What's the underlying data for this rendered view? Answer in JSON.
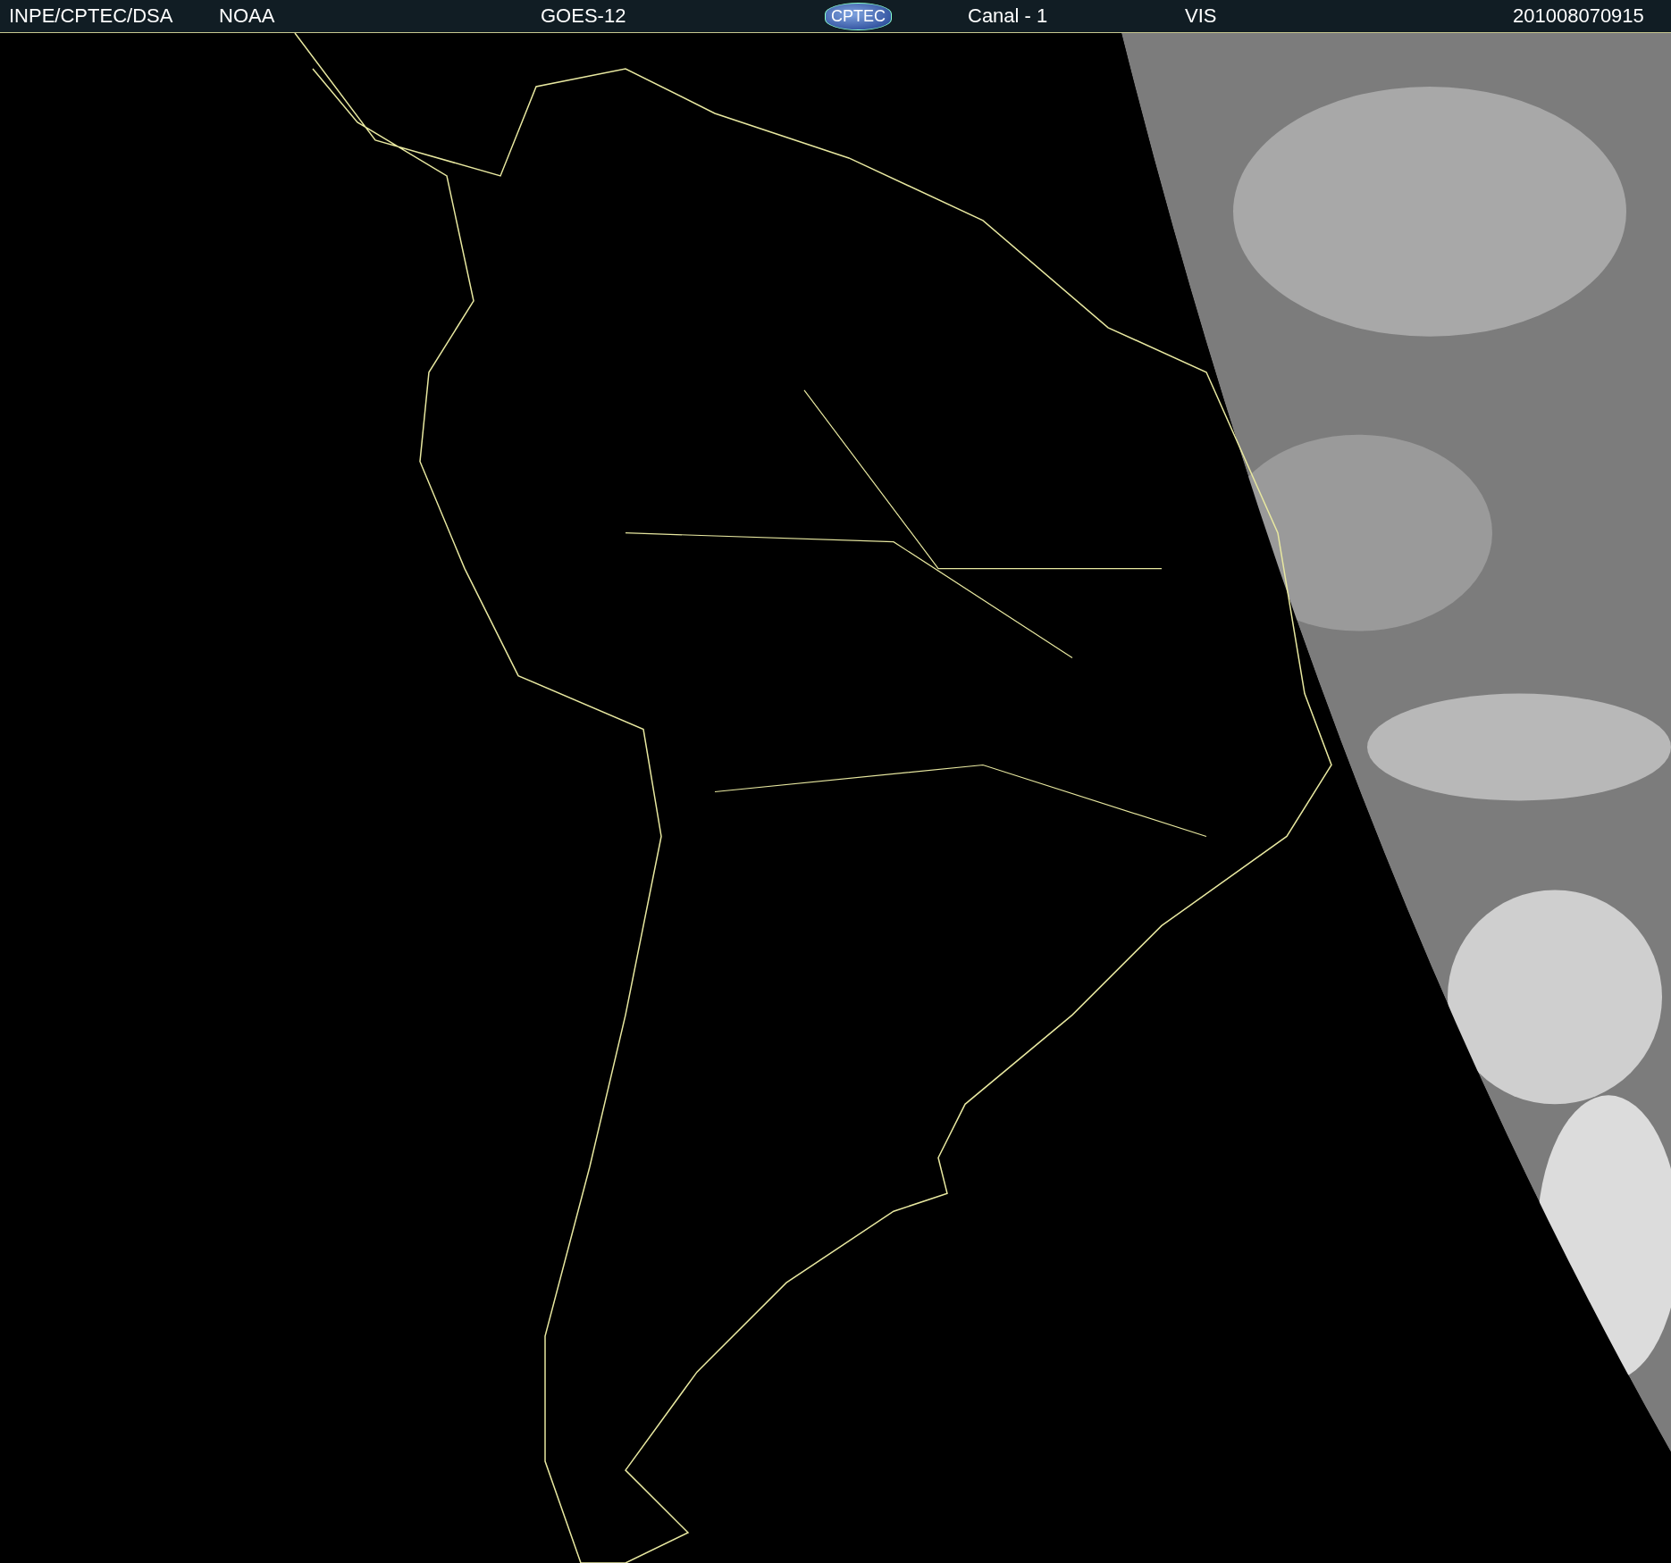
{
  "header": {
    "items": [
      {
        "kind": "text",
        "label": "INPE/CPTEC/DSA"
      },
      {
        "kind": "text",
        "label": "NOAA"
      },
      {
        "kind": "text",
        "label": "GOES-12"
      },
      {
        "kind": "logo",
        "label": "CPTEC"
      },
      {
        "kind": "text",
        "label": "Canal - 1"
      },
      {
        "kind": "text",
        "label": "VIS"
      },
      {
        "kind": "text",
        "label": "201008070915"
      }
    ]
  }
}
